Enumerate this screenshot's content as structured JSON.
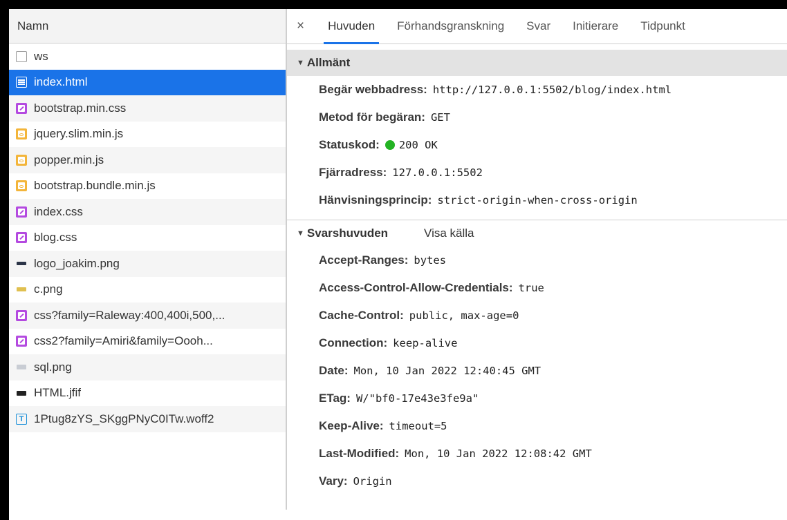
{
  "name_header": "Namn",
  "files": [
    {
      "name": "ws",
      "icon": "blank-file-icon"
    },
    {
      "name": "index.html",
      "icon": "document-icon",
      "selected": true
    },
    {
      "name": "bootstrap.min.css",
      "icon": "css-file-icon"
    },
    {
      "name": "jquery.slim.min.js",
      "icon": "js-file-icon"
    },
    {
      "name": "popper.min.js",
      "icon": "js-file-icon"
    },
    {
      "name": "bootstrap.bundle.min.js",
      "icon": "js-file-icon"
    },
    {
      "name": "index.css",
      "icon": "css-file-icon"
    },
    {
      "name": "blog.css",
      "icon": "css-file-icon"
    },
    {
      "name": "logo_joakim.png",
      "icon": "image-file-icon"
    },
    {
      "name": "c.png",
      "icon": "image-file-icon"
    },
    {
      "name": "css?family=Raleway:400,400i,500,...",
      "icon": "css-file-icon"
    },
    {
      "name": "css2?family=Amiri&family=Oooh...",
      "icon": "css-file-icon"
    },
    {
      "name": "sql.png",
      "icon": "image-file-icon"
    },
    {
      "name": "HTML.jfif",
      "icon": "image-file-icon"
    },
    {
      "name": "1Ptug8zYS_SKggPNyC0ITw.woff2",
      "icon": "font-file-icon"
    }
  ],
  "tabs": {
    "close": "×",
    "items": [
      "Huvuden",
      "Förhandsgranskning",
      "Svar",
      "Initierare",
      "Tidpunkt"
    ],
    "active": "Huvuden"
  },
  "general": {
    "title": "Allmänt",
    "rows": [
      {
        "key": "Begär webbadress:",
        "value": "http://127.0.0.1:5502/blog/index.html"
      },
      {
        "key": "Metod för begäran:",
        "value": "GET"
      },
      {
        "key": "Statuskod:",
        "value": "200 OK",
        "status_color": "#23b323"
      },
      {
        "key": "Fjärradress:",
        "value": "127.0.0.1:5502"
      },
      {
        "key": "Hänvisningsprincip:",
        "value": "strict-origin-when-cross-origin"
      }
    ]
  },
  "response_headers": {
    "title": "Svarshuvuden",
    "view_source": "Visa källa",
    "rows": [
      {
        "key": "Accept-Ranges:",
        "value": "bytes"
      },
      {
        "key": "Access-Control-Allow-Credentials:",
        "value": "true"
      },
      {
        "key": "Cache-Control:",
        "value": "public, max-age=0"
      },
      {
        "key": "Connection:",
        "value": "keep-alive"
      },
      {
        "key": "Date:",
        "value": "Mon, 10 Jan 2022 12:40:45 GMT"
      },
      {
        "key": "ETag:",
        "value": "W/\"bf0-17e43e3fe9a\""
      },
      {
        "key": "Keep-Alive:",
        "value": "timeout=5"
      },
      {
        "key": "Last-Modified:",
        "value": "Mon, 10 Jan 2022 12:08:42 GMT"
      },
      {
        "key": "Vary:",
        "value": "Origin"
      }
    ]
  },
  "colors": {
    "accent": "#1a73e8",
    "status_ok": "#23b323"
  }
}
